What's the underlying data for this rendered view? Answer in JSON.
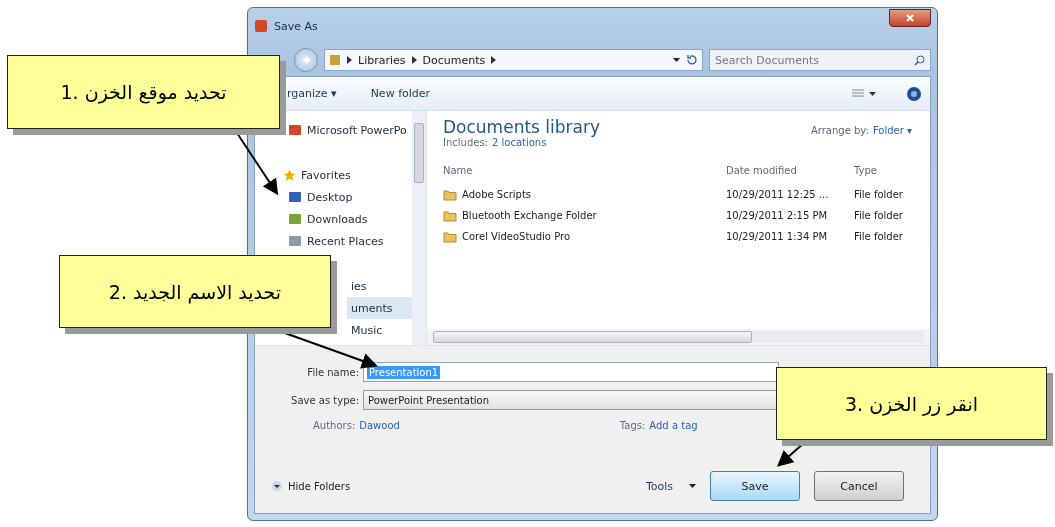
{
  "window": {
    "title": "Save As"
  },
  "address": {
    "crumbs": [
      "Libraries",
      "Documents"
    ],
    "search_placeholder": "Search Documents"
  },
  "toolbar": {
    "organize": "rganize ▾",
    "new_folder": "New folder"
  },
  "nav": [
    {
      "label": "Microsoft PowerPo",
      "kind": "item"
    },
    {
      "label": "Favorites",
      "kind": "group"
    },
    {
      "label": "Desktop",
      "kind": "item"
    },
    {
      "label": "Downloads",
      "kind": "item"
    },
    {
      "label": "Recent Places",
      "kind": "item"
    },
    {
      "label": "ies",
      "kind": "partial-group",
      "selected": false
    },
    {
      "label": "uments",
      "kind": "partial",
      "selected": true
    },
    {
      "label": "Music",
      "kind": "partial",
      "selected": false
    }
  ],
  "library": {
    "title": "Documents library",
    "includes": "Includes:",
    "locations": "2 locations",
    "arrange_label": "Arrange by:",
    "arrange_value": "Folder ▾"
  },
  "table": {
    "columns": [
      "Name",
      "Date modified",
      "Type"
    ],
    "rows": [
      [
        "Adobe Scripts",
        "10/29/2011 12:25 ...",
        "File folder"
      ],
      [
        "Bluetooth Exchange Folder",
        "10/29/2011 2:15 PM",
        "File folder"
      ],
      [
        "Corel VideoStudio Pro",
        "10/29/2011 1:34 PM",
        "File folder"
      ]
    ]
  },
  "form": {
    "file_name_label": "File name:",
    "file_name": "Presentation1",
    "type_label": "Save as type:",
    "type": "PowerPoint Presentation",
    "authors_label": "Authors:",
    "authors": "Dawood",
    "tags_label": "Tags:",
    "tags": "Add a tag"
  },
  "footer": {
    "hide_folders": "Hide Folders",
    "tools": "Tools",
    "save": "Save",
    "cancel": "Cancel"
  },
  "callouts": [
    "1. تحديد موقع الخزن",
    "2. تحديد الاسم الجديد",
    "3. انقر زر الخزن"
  ]
}
